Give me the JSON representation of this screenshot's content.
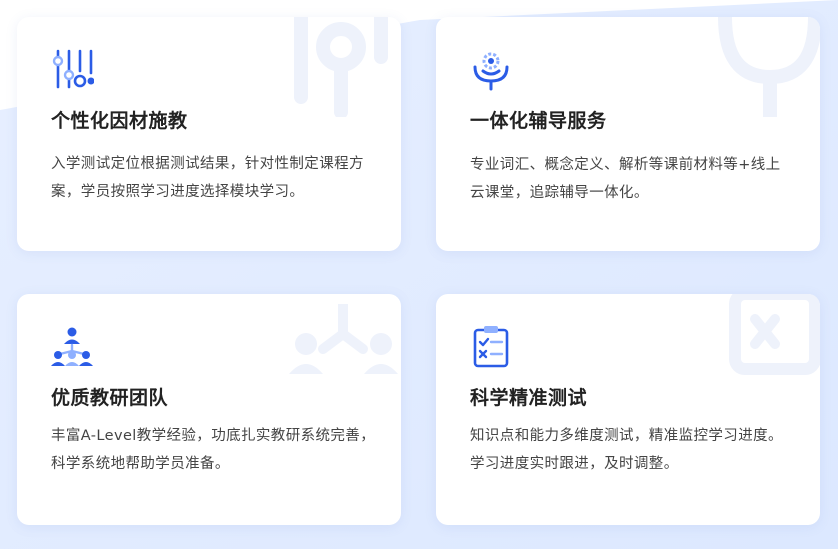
{
  "features": [
    {
      "title": "个性化因材施教",
      "desc": "入学测试定位根据测试结果，针对性制定课程方案，学员按照学习进度选择模块学习。",
      "icon": "sliders-icon"
    },
    {
      "title": "一体化辅导服务",
      "desc": "专业词汇、概念定义、解析等课前材料等+线上云课堂，追踪辅导一体化。",
      "icon": "gear-service-icon"
    },
    {
      "title": "优质教研团队",
      "desc": "丰富A-Level教学经验，功底扎实教研系统完善，科学系统地帮助学员准备。",
      "icon": "team-icon"
    },
    {
      "title": "科学精准测试",
      "desc": "知识点和能力多维度测试，精准监控学习进度。学习进度实时跟进，及时调整。",
      "icon": "clipboard-check-icon"
    }
  ],
  "colors": {
    "accent": "#2b5ce6",
    "accent_light": "#8fb0ff",
    "title": "#222222",
    "text": "#444444",
    "watermark": "#edf2fc"
  }
}
